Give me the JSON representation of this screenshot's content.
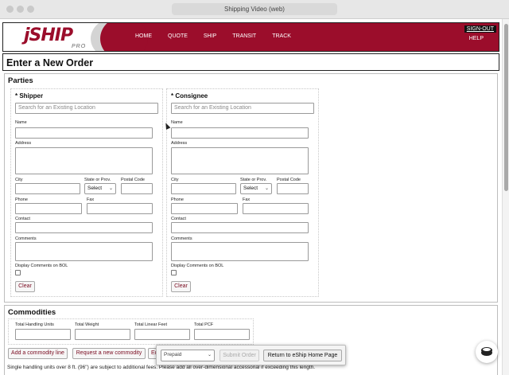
{
  "window": {
    "title": "Shipping Video (web)"
  },
  "brand": {
    "logo": "jSHIP",
    "logo_sub": "PRO",
    "color": "#9b0d2b"
  },
  "nav": {
    "items": [
      "HOME",
      "QUOTE",
      "SHIP",
      "TRANSIT",
      "TRACK"
    ],
    "signout": "SIGN-OUT",
    "help": "HELP"
  },
  "page": {
    "title": "Enter a New Order"
  },
  "parties": {
    "title": "Parties",
    "shipper": {
      "title": "* Shipper",
      "search_placeholder": "Search for an Existing Location",
      "labels": {
        "name": "Name",
        "address": "Address",
        "city": "City",
        "state": "State or Prov.",
        "postal": "Postal Code",
        "phone": "Phone",
        "fax": "Fax",
        "contact": "Contact",
        "comments": "Comments",
        "display_comments": "Display Comments on BOL"
      },
      "state_value": "Select",
      "clear": "Clear"
    },
    "consignee": {
      "title": "* Consignee",
      "search_placeholder": "Search for an Existing Location",
      "labels": {
        "name": "Name",
        "address": "Address",
        "city": "City",
        "state": "State or Prov.",
        "postal": "Postal Code",
        "phone": "Phone",
        "fax": "Fax",
        "contact": "Contact",
        "comments": "Comments",
        "display_comments": "Display Comments on BOL"
      },
      "state_value": "Select",
      "clear": "Clear"
    }
  },
  "commodities": {
    "title": "Commodities",
    "labels": {
      "units": "Total Handling Units",
      "weight": "Total Weight",
      "linear": "Total Linear Feet",
      "pcf": "Total PCF"
    },
    "add_line": "Add a commodity line",
    "request": "Request a new commodity",
    "edit": "Ed",
    "note": "Single handling units over 8 ft. (96\") are subject to additional fees. Please add all over-dimensional accessorial if exceeding this length."
  },
  "actions": {
    "payment": "Prepaid",
    "submit": "Submit Order",
    "return": "Return to eShip Home Page"
  },
  "icons": {
    "chat": "chat-bubble-icon",
    "cursor": "mouse-cursor-icon"
  }
}
